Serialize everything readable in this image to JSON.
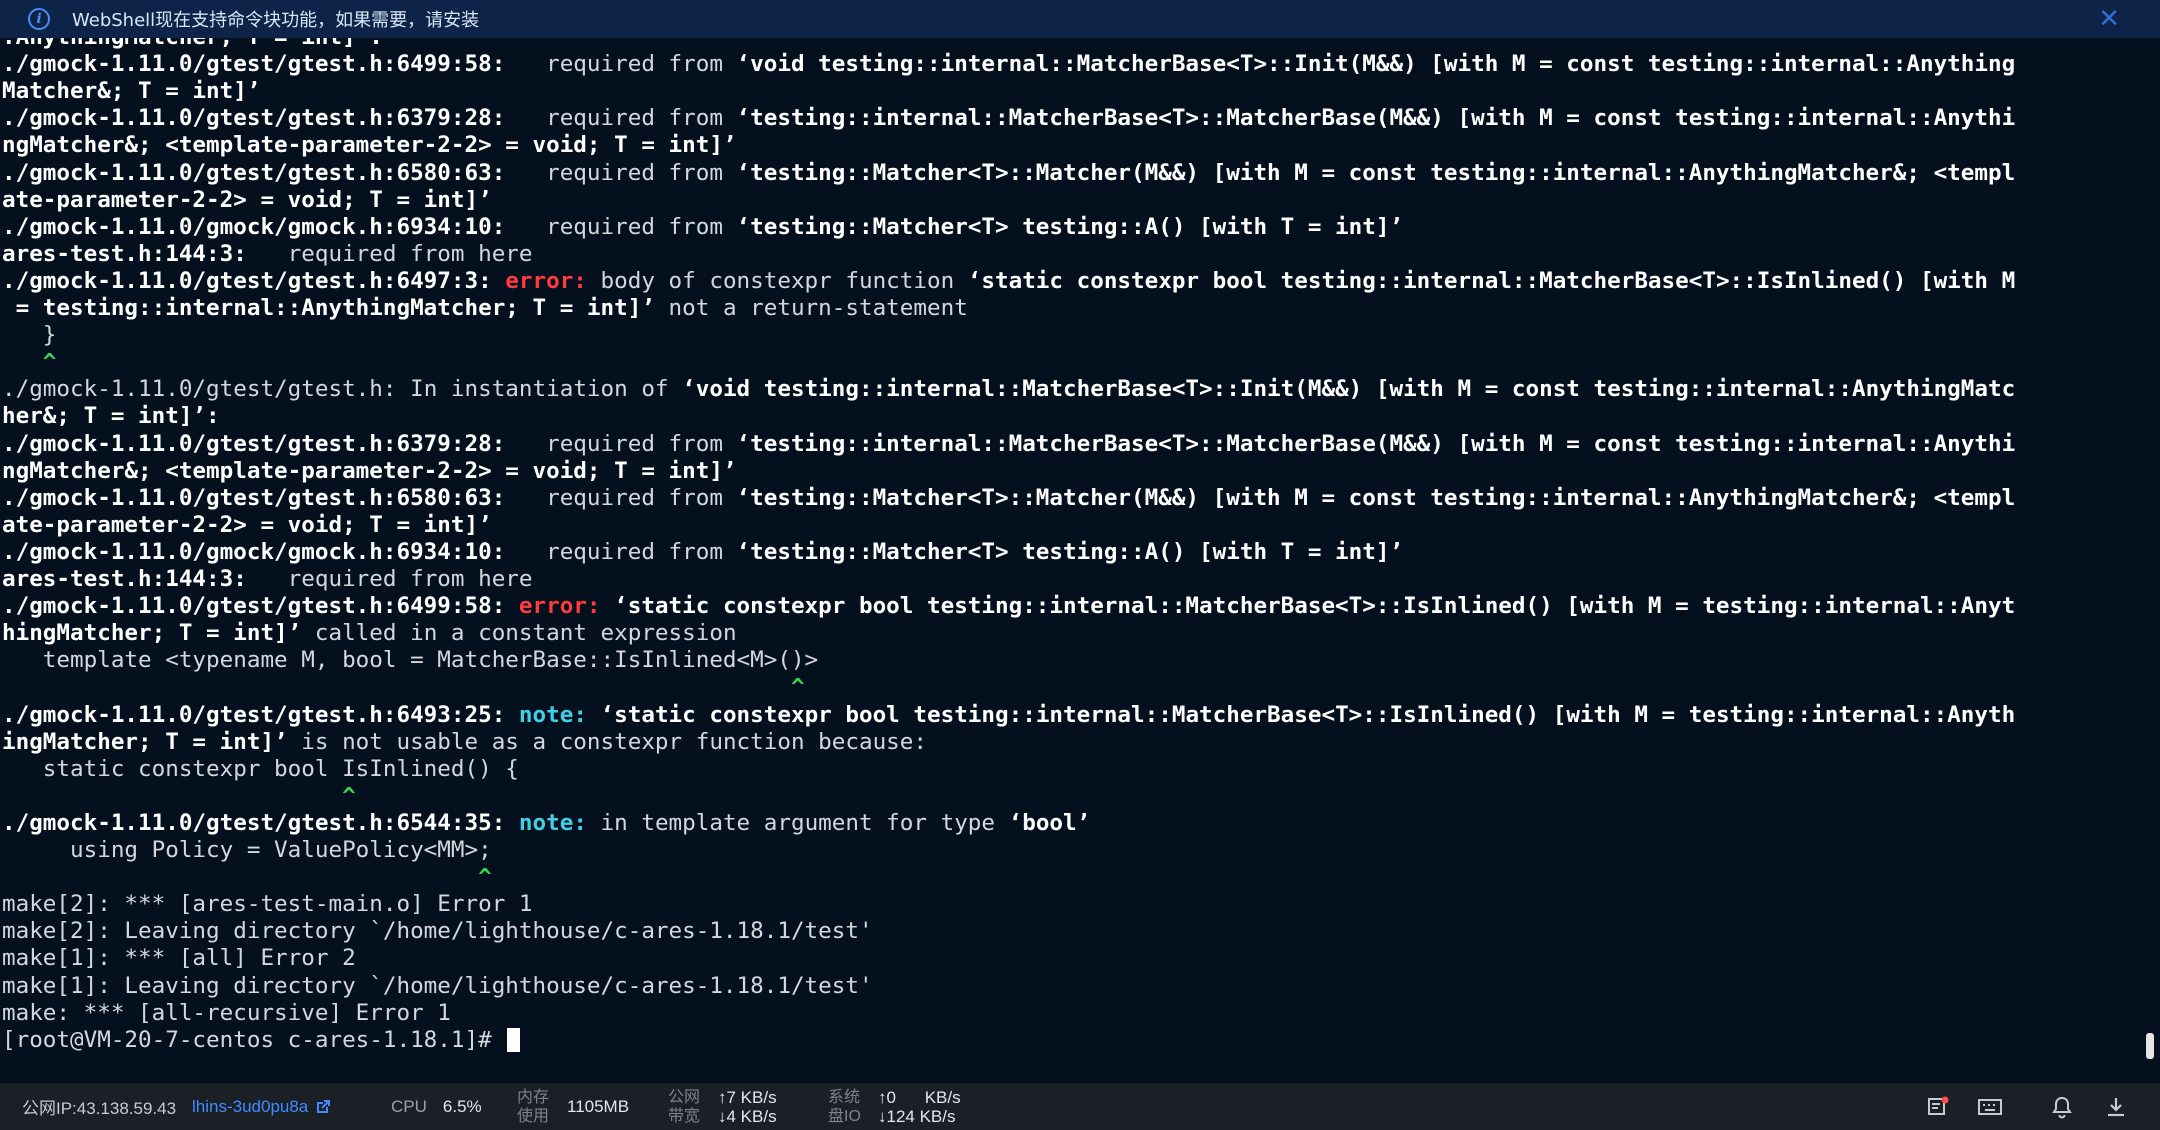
{
  "banner": {
    "message": "WebShell现在支持命令块功能，如果需要，请安装",
    "info_icon": "info-icon",
    "close_icon": "close-icon",
    "close_glyph": "✕",
    "info_glyph": "i"
  },
  "terminal": {
    "lines": [
      [
        {
          "t": ":AnythingMatcher; T = int]’:",
          "s": "bold"
        }
      ],
      [
        {
          "t": "./gmock-1.11.0/gtest/gtest.h:6499:58:",
          "s": "bold"
        },
        {
          "t": "   required from ",
          "s": ""
        },
        {
          "t": "‘void testing::internal::MatcherBase<T>::Init(M&&) [with M = const testing::internal::Anything",
          "s": "bold"
        }
      ],
      [
        {
          "t": "Matcher&; T = int]’",
          "s": "bold"
        }
      ],
      [
        {
          "t": "./gmock-1.11.0/gtest/gtest.h:6379:28:",
          "s": "bold"
        },
        {
          "t": "   required from ",
          "s": ""
        },
        {
          "t": "‘testing::internal::MatcherBase<T>::MatcherBase(M&&) [with M = const testing::internal::Anythi",
          "s": "bold"
        }
      ],
      [
        {
          "t": "ngMatcher&; <template-parameter-2-2> = void; T = int]’",
          "s": "bold"
        }
      ],
      [
        {
          "t": "./gmock-1.11.0/gtest/gtest.h:6580:63:",
          "s": "bold"
        },
        {
          "t": "   required from ",
          "s": ""
        },
        {
          "t": "‘testing::Matcher<T>::Matcher(M&&) [with M = const testing::internal::AnythingMatcher&; <templ",
          "s": "bold"
        }
      ],
      [
        {
          "t": "ate-parameter-2-2> = void; T = int]’",
          "s": "bold"
        }
      ],
      [
        {
          "t": "./gmock-1.11.0/gmock/gmock.h:6934:10:",
          "s": "bold"
        },
        {
          "t": "   required from ",
          "s": ""
        },
        {
          "t": "‘testing::Matcher<T> testing::A() [with T = int]’",
          "s": "bold"
        }
      ],
      [
        {
          "t": "ares-test.h:144:3:",
          "s": "bold"
        },
        {
          "t": "   required from here",
          "s": ""
        }
      ],
      [
        {
          "t": "./gmock-1.11.0/gtest/gtest.h:6497:3: ",
          "s": "bold"
        },
        {
          "t": "error: ",
          "s": "error"
        },
        {
          "t": "body of constexpr function ",
          "s": ""
        },
        {
          "t": "‘static constexpr bool testing::internal::MatcherBase<T>::IsInlined() [with M",
          "s": "bold"
        }
      ],
      [
        {
          "t": " = testing::internal::AnythingMatcher; T = int]’",
          "s": "bold"
        },
        {
          "t": " not a return-statement",
          "s": ""
        }
      ],
      [
        {
          "t": "   }",
          "s": ""
        }
      ],
      [
        {
          "t": "   ^",
          "s": "caret"
        }
      ],
      [
        {
          "t": "./gmock-1.11.0/gtest/gtest.h:",
          "s": ""
        },
        {
          "t": " In instantiation of ",
          "s": ""
        },
        {
          "t": "‘void testing::internal::MatcherBase<T>::Init(M&&) [with M = const testing::internal::AnythingMatc",
          "s": "bold"
        }
      ],
      [
        {
          "t": "her&; T = int]’:",
          "s": "bold"
        }
      ],
      [
        {
          "t": "./gmock-1.11.0/gtest/gtest.h:6379:28:",
          "s": "bold"
        },
        {
          "t": "   required from ",
          "s": ""
        },
        {
          "t": "‘testing::internal::MatcherBase<T>::MatcherBase(M&&) [with M = const testing::internal::Anythi",
          "s": "bold"
        }
      ],
      [
        {
          "t": "ngMatcher&; <template-parameter-2-2> = void; T = int]’",
          "s": "bold"
        }
      ],
      [
        {
          "t": "./gmock-1.11.0/gtest/gtest.h:6580:63:",
          "s": "bold"
        },
        {
          "t": "   required from ",
          "s": ""
        },
        {
          "t": "‘testing::Matcher<T>::Matcher(M&&) [with M = const testing::internal::AnythingMatcher&; <templ",
          "s": "bold"
        }
      ],
      [
        {
          "t": "ate-parameter-2-2> = void; T = int]’",
          "s": "bold"
        }
      ],
      [
        {
          "t": "./gmock-1.11.0/gmock/gmock.h:6934:10:",
          "s": "bold"
        },
        {
          "t": "   required from ",
          "s": ""
        },
        {
          "t": "‘testing::Matcher<T> testing::A() [with T = int]’",
          "s": "bold"
        }
      ],
      [
        {
          "t": "ares-test.h:144:3:",
          "s": "bold"
        },
        {
          "t": "   required from here",
          "s": ""
        }
      ],
      [
        {
          "t": "./gmock-1.11.0/gtest/gtest.h:6499:58: ",
          "s": "bold"
        },
        {
          "t": "error: ",
          "s": "error"
        },
        {
          "t": "‘static constexpr bool testing::internal::MatcherBase<T>::IsInlined() [with M = testing::internal::Anyt",
          "s": "bold"
        }
      ],
      [
        {
          "t": "hingMatcher; T = int]’",
          "s": "bold"
        },
        {
          "t": " called in a constant expression",
          "s": ""
        }
      ],
      [
        {
          "t": "   template <typename M, bool = MatcherBase::IsInlined<M>()>",
          "s": ""
        }
      ],
      [
        {
          "t": "                                                          ^",
          "s": "caret"
        }
      ],
      [
        {
          "t": "./gmock-1.11.0/gtest/gtest.h:6493:25: ",
          "s": "bold"
        },
        {
          "t": "note: ",
          "s": "note"
        },
        {
          "t": "‘static constexpr bool testing::internal::MatcherBase<T>::IsInlined() [with M = testing::internal::Anyth",
          "s": "bold"
        }
      ],
      [
        {
          "t": "ingMatcher; T = int]’",
          "s": "bold"
        },
        {
          "t": " is not usable as a constexpr function because:",
          "s": ""
        }
      ],
      [
        {
          "t": "   static constexpr bool IsInlined() {",
          "s": ""
        }
      ],
      [
        {
          "t": "                         ^",
          "s": "caret"
        }
      ],
      [
        {
          "t": "./gmock-1.11.0/gtest/gtest.h:6544:35: ",
          "s": "bold"
        },
        {
          "t": "note: ",
          "s": "note"
        },
        {
          "t": "in template argument for type ",
          "s": ""
        },
        {
          "t": "‘bool’",
          "s": "bold"
        }
      ],
      [
        {
          "t": "     using Policy = ValuePolicy<MM>;",
          "s": ""
        }
      ],
      [
        {
          "t": "                                   ^",
          "s": "caret"
        }
      ],
      [
        {
          "t": "make[2]: *** [ares-test-main.o] Error 1",
          "s": ""
        }
      ],
      [
        {
          "t": "make[2]: Leaving directory `/home/lighthouse/c-ares-1.18.1/test'",
          "s": ""
        }
      ],
      [
        {
          "t": "make[1]: *** [all] Error 2",
          "s": ""
        }
      ],
      [
        {
          "t": "make[1]: Leaving directory `/home/lighthouse/c-ares-1.18.1/test'",
          "s": ""
        }
      ],
      [
        {
          "t": "make: *** [all-recursive] Error 1",
          "s": ""
        }
      ],
      [
        {
          "t": "[root@VM-20-7-centos c-ares-1.18.1]# ",
          "s": ""
        }
      ]
    ]
  },
  "statusbar": {
    "public_ip": "公网IP:43.138.59.43",
    "instance_id": "lhins-3ud0pu8a",
    "cpu_label": "CPU",
    "cpu_value": "6.5%",
    "mem_label_1": "内存",
    "mem_label_2": "使用",
    "mem_value": "1105MB",
    "net_label_1": "公网",
    "net_label_2": "带宽",
    "net_up": "↑7 KB/s",
    "net_down": "↓4 KB/s",
    "disk_label_1": "系统",
    "disk_label_2": "盘IO",
    "disk_up": "↑0",
    "disk_up_unit": "KB/s",
    "disk_down": "↓124 KB/s",
    "icons": [
      "external-link-icon",
      "notification-settings-icon",
      "keyboard-icon",
      "bell-icon",
      "download-icon"
    ]
  },
  "colors": {
    "background": "#05101f",
    "error": "#ff3b3b",
    "note": "#3fd0e6",
    "caret": "#39d353",
    "link": "#3f8cff"
  }
}
